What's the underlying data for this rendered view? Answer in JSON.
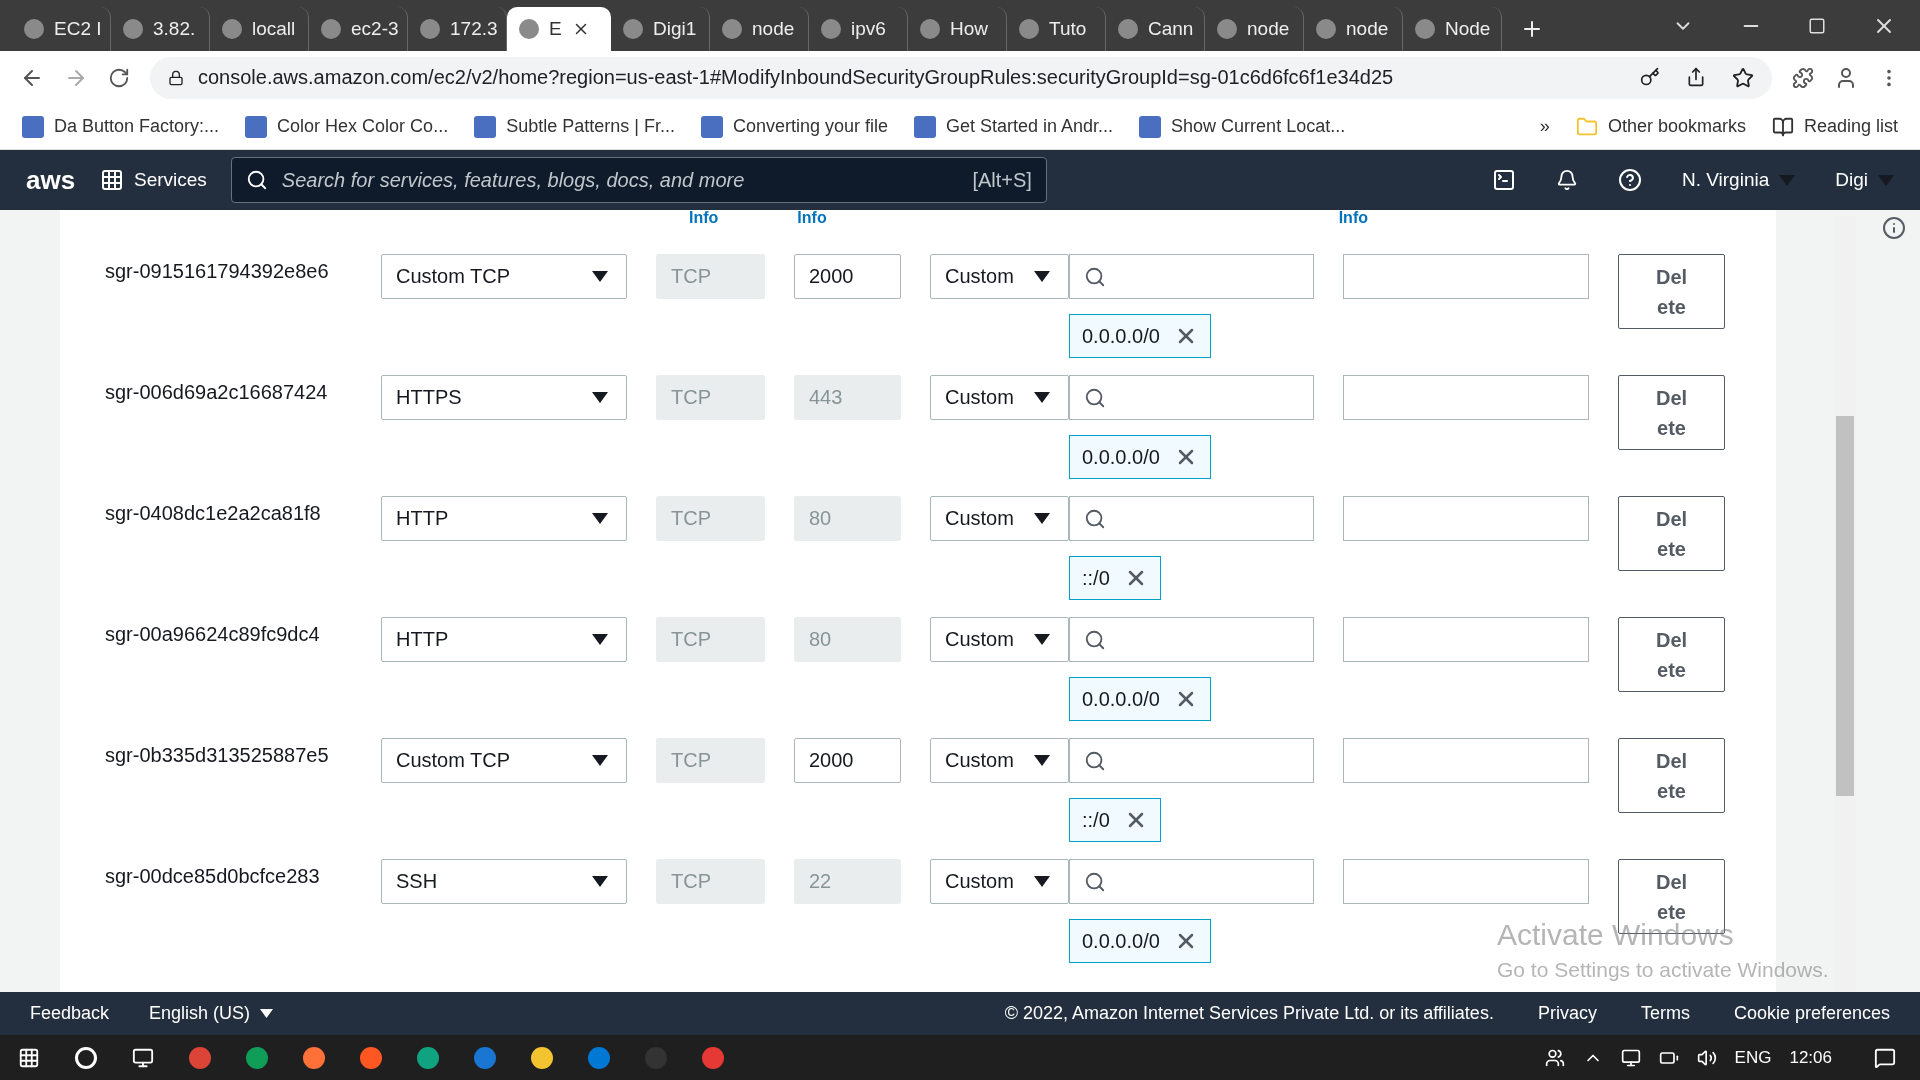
{
  "browser": {
    "tabs": [
      {
        "label": "EC2 I",
        "selected": false
      },
      {
        "label": "3.82.",
        "selected": false
      },
      {
        "label": "locall",
        "selected": false
      },
      {
        "label": "ec2-3",
        "selected": false
      },
      {
        "label": "172.3",
        "selected": false
      },
      {
        "label": "E",
        "selected": true
      },
      {
        "label": "Digi1",
        "selected": false
      },
      {
        "label": "node",
        "selected": false
      },
      {
        "label": "ipv6",
        "selected": false
      },
      {
        "label": "How",
        "selected": false
      },
      {
        "label": "Tuto",
        "selected": false
      },
      {
        "label": "Cann",
        "selected": false
      },
      {
        "label": "node",
        "selected": false
      },
      {
        "label": "node",
        "selected": false
      },
      {
        "label": "Node",
        "selected": false
      }
    ],
    "address": "console.aws.amazon.com/ec2/v2/home?region=us-east-1#ModifyInboundSecurityGroupRules:securityGroupId=sg-01c6d6fc6f1e34d25",
    "bookmarks": [
      "Da Button Factory:...",
      "Color Hex Color Co...",
      "Subtle Patterns | Fr...",
      "Converting your file",
      "Get Started in Andr...",
      "Show Current Locat..."
    ],
    "more_bookmarks": "»",
    "other_bookmarks": "Other bookmarks",
    "reading_list": "Reading list"
  },
  "aws_header": {
    "logo": "aws",
    "services": "Services",
    "search_placeholder": "Search for services, features, blogs, docs, and more",
    "shortcut": "[Alt+S]",
    "region": "N. Virginia",
    "account": "Digi"
  },
  "column_info": [
    "Info",
    "Info",
    "Info"
  ],
  "rules": [
    {
      "id": "sgr-0915161794392e8e6",
      "type": "Custom TCP",
      "protocol": "TCP",
      "port": "2000",
      "port_disabled": false,
      "source": "Custom",
      "cidr": "0.0.0.0/0",
      "action": "Delete"
    },
    {
      "id": "sgr-006d69a2c16687424",
      "type": "HTTPS",
      "protocol": "TCP",
      "port": "443",
      "port_disabled": true,
      "source": "Custom",
      "cidr": "0.0.0.0/0",
      "action": "Delete"
    },
    {
      "id": "sgr-0408dc1e2a2ca81f8",
      "type": "HTTP",
      "protocol": "TCP",
      "port": "80",
      "port_disabled": true,
      "source": "Custom",
      "cidr": "::/0",
      "action": "Delete"
    },
    {
      "id": "sgr-00a96624c89fc9dc4",
      "type": "HTTP",
      "protocol": "TCP",
      "port": "80",
      "port_disabled": true,
      "source": "Custom",
      "cidr": "0.0.0.0/0",
      "action": "Delete"
    },
    {
      "id": "sgr-0b335d313525887e5",
      "type": "Custom TCP",
      "protocol": "TCP",
      "port": "2000",
      "port_disabled": false,
      "source": "Custom",
      "cidr": "::/0",
      "action": "Delete"
    },
    {
      "id": "sgr-00dce85d0bcfce283",
      "type": "SSH",
      "protocol": "TCP",
      "port": "22",
      "port_disabled": true,
      "source": "Custom",
      "cidr": "0.0.0.0/0",
      "action": "Delete"
    }
  ],
  "footer": {
    "feedback": "Feedback",
    "language": "English (US)",
    "copyright": "© 2022, Amazon Internet Services Private Ltd. or its affiliates.",
    "links": [
      "Privacy",
      "Terms",
      "Cookie preferences"
    ]
  },
  "os_notice": {
    "title": "Activate Windows",
    "text": "Go to Settings to activate Windows."
  },
  "taskbar": {
    "language": "ENG",
    "time": "12:06"
  }
}
